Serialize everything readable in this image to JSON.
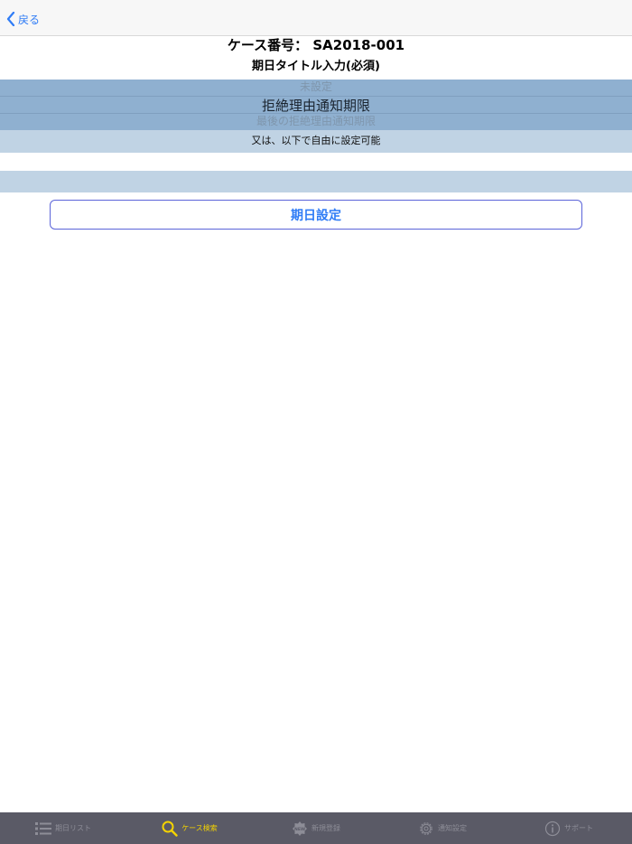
{
  "navbar": {
    "back_label": "戻る"
  },
  "header": {
    "case_title": "ケース番号： SA2018-001",
    "subtitle": "期日タイトル入力(必須)"
  },
  "picker": {
    "items": [
      "未設定",
      "拒絶理由通知期限",
      "最後の拒絶理由通知期限"
    ],
    "selected_index": 1
  },
  "free_input": {
    "hint": "又は、以下で自由に設定可能",
    "value": "",
    "placeholder": ""
  },
  "actions": {
    "set_date_label": "期日設定"
  },
  "tabbar": {
    "tabs": [
      {
        "label": "期日リスト",
        "icon": "list-icon",
        "active": false
      },
      {
        "label": "ケース検索",
        "icon": "search-icon",
        "active": true
      },
      {
        "label": "新規登録",
        "icon": "new-badge-icon",
        "active": false
      },
      {
        "label": "通知設定",
        "icon": "gear-icon",
        "active": false
      },
      {
        "label": "サポート",
        "icon": "info-icon",
        "active": false
      }
    ]
  },
  "colors": {
    "accent": "#2f7cf6",
    "tab_active": "#f4d300",
    "tab_inactive": "#8d8d97",
    "picker_bg": "#8fb0d0",
    "band_bg": "#c0d3e4"
  }
}
